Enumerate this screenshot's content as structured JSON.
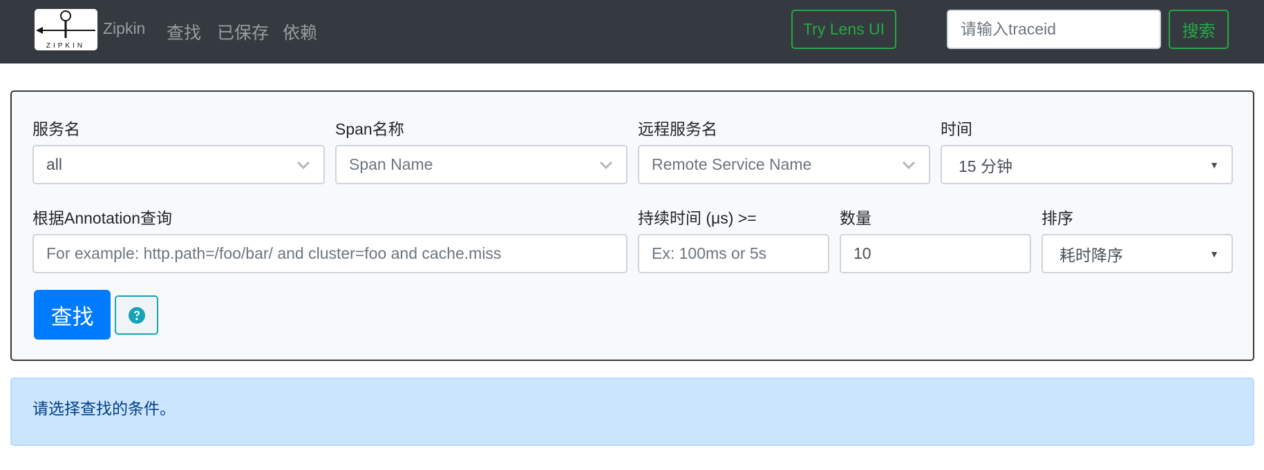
{
  "navbar": {
    "logo_text": "ZIPKIN",
    "brand": "Zipkin",
    "links": [
      {
        "label": "查找"
      },
      {
        "label": "已保存"
      },
      {
        "label": "依赖"
      }
    ],
    "lens_button": "Try Lens UI",
    "traceid_placeholder": "请输入traceid",
    "search_button": "搜索",
    "accent_color": "#28a745"
  },
  "search_form": {
    "service_name": {
      "label": "服务名",
      "value": "all"
    },
    "span_name": {
      "label": "Span名称",
      "placeholder": "Span Name"
    },
    "remote_service_name": {
      "label": "远程服务名",
      "placeholder": "Remote Service Name"
    },
    "time": {
      "label": "时间",
      "value": "15 分钟"
    },
    "annotation_query": {
      "label": "根据Annotation查询",
      "placeholder": "For example: http.path=/foo/bar/ and cluster=foo and cache.miss"
    },
    "duration": {
      "label": "持续时间 (μs) >=",
      "placeholder": "Ex: 100ms or 5s"
    },
    "limit": {
      "label": "数量",
      "value": "10"
    },
    "sort": {
      "label": "排序",
      "value": "耗时降序"
    },
    "find_button": "查找",
    "help_icon": "question-circle-icon",
    "primary_color": "#007bff",
    "help_color": "#17a2b8"
  },
  "alert": {
    "message": "请选择查找的条件。",
    "background": "#cce5ff"
  }
}
